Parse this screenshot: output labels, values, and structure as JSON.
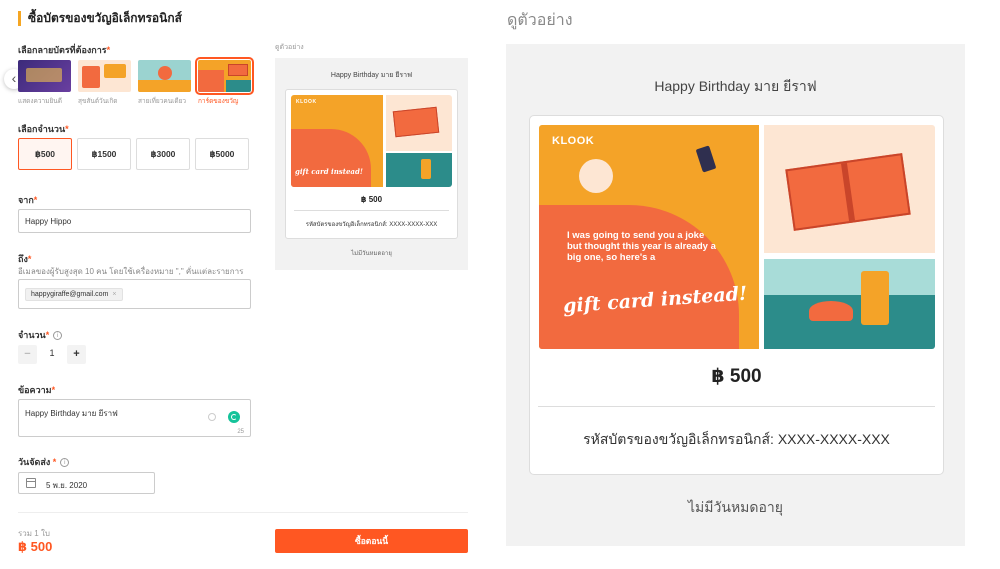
{
  "form": {
    "title": "ซื้อบัตรของขวัญอิเล็กทรอนิกส์",
    "design_label": "เลือกลายบัตรที่ต้องการ",
    "designs": [
      {
        "caption": "แสดงความยินดี",
        "selected": false
      },
      {
        "caption": "สุขสันต์วันเกิด",
        "selected": false
      },
      {
        "caption": "สายเที่ยวคนเดียว",
        "selected": false
      },
      {
        "caption": "การ์ดของขวัญ",
        "selected": true
      }
    ],
    "amount_label": "เลือกจำนวน",
    "amounts": [
      {
        "label": "฿500",
        "selected": true
      },
      {
        "label": "฿1500",
        "selected": false
      },
      {
        "label": "฿3000",
        "selected": false
      },
      {
        "label": "฿5000",
        "selected": false
      }
    ],
    "from_label": "จาก",
    "from_value": "Happy Hippo",
    "to_label": "ถึง",
    "to_hint": "อีเมลของผู้รับสูงสุด 10 คน โดยใช้เครื่องหมาย \",\" คั่นแต่ละรายการ",
    "to_chip": "happygiraffe@gmail.com",
    "to_chip_close": "×",
    "qty_label": "จำนวน",
    "qty_minus": "−",
    "qty_value": "1",
    "qty_plus": "+",
    "message_label": "ข้อความ",
    "message_value": "Happy Birthday มาย ยีราฟ",
    "message_count": "25",
    "date_label": "วันจัดส่ง",
    "date_value": "5 พ.ย. 2020",
    "total_label": "รวม 1 ใบ",
    "total_value": "฿ 500",
    "buy_label": "ซื้อตอนนี้"
  },
  "preview_small": {
    "label": "ดูตัวอย่าง",
    "greeting": "Happy Birthday มาย ยีราฟ",
    "amount": "฿ 500",
    "code": "รหัสบัตรของขวัญอิเล็กทรอนิกส์: XXXX-XXXX-XXX",
    "no_expiry": "ไม่มีวันหมดอายุ"
  },
  "preview_large": {
    "label": "ดูตัวอย่าง",
    "greeting": "Happy Birthday มาย ยีราฟ",
    "amount": "฿ 500",
    "code": "รหัสบัตรของขวัญอิเล็กทรอนิกส์: XXXX-XXXX-XXX",
    "no_expiry": "ไม่มีวันหมดอายุ"
  },
  "card_art": {
    "brand": "KLOOK",
    "message": "I was going to send you a joke but thought this year is already a big one, so here's a",
    "tagline": "gift card instead!"
  },
  "icons": {
    "arrow_left": "‹",
    "info": "i",
    "calendar": "calendar-icon"
  },
  "colors": {
    "accent": "#ff5722",
    "title_bar": "#f5a623",
    "art_orange": "#f4a328",
    "art_red": "#f26a3f",
    "art_teal": "#2c8c8a"
  }
}
